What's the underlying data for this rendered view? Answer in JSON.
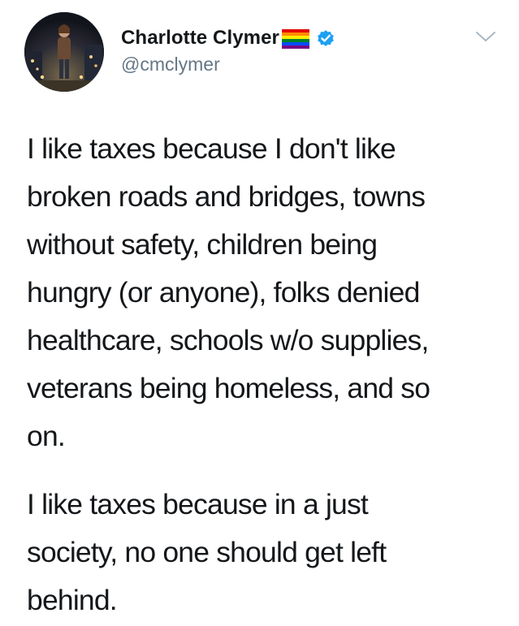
{
  "author": {
    "display_name": "Charlotte Clymer",
    "handle": "@cmclymer",
    "flag_icon": "rainbow-flag-icon",
    "verified_icon": "verified-badge-icon",
    "verified_color": "#1da1f2"
  },
  "menu": {
    "icon": "chevron-down-icon"
  },
  "tweet": {
    "paragraphs": [
      {
        "lines": [
          "I like taxes because I don't like",
          "broken roads and bridges, towns",
          "without safety, children being",
          "hungry (or anyone), folks denied",
          "healthcare, schools w/o supplies,",
          "veterans being homeless, and so",
          "on."
        ]
      },
      {
        "lines": [
          "I like taxes because in a just",
          "society, no one should get left",
          "behind."
        ]
      }
    ]
  }
}
